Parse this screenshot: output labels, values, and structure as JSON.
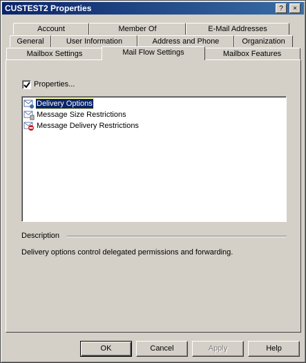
{
  "window": {
    "title": "CUSTEST2 Properties",
    "close_glyph": "×",
    "help_glyph": "?"
  },
  "tabs": {
    "row1": [
      "Account",
      "Member Of",
      "E-Mail Addresses"
    ],
    "row2": [
      "General",
      "User Information",
      "Address and Phone",
      "Organization"
    ],
    "row3": [
      "Mailbox Settings",
      "Mail Flow Settings",
      "Mailbox Features"
    ],
    "active": "Mail Flow Settings"
  },
  "panel": {
    "properties_label": "Properties...",
    "properties_checked": true,
    "items": [
      {
        "label": "Delivery Options",
        "icon": "delivery-options-icon",
        "selected": true
      },
      {
        "label": "Message Size Restrictions",
        "icon": "message-size-icon",
        "selected": false
      },
      {
        "label": "Message Delivery Restrictions",
        "icon": "delivery-restrictions-icon",
        "selected": false
      }
    ],
    "description_label": "Description",
    "description_text": "Delivery options control delegated permissions and forwarding."
  },
  "buttons": {
    "ok": "OK",
    "cancel": "Cancel",
    "apply": "Apply",
    "help": "Help"
  }
}
